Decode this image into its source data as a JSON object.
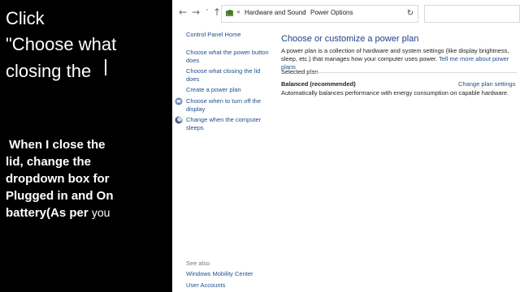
{
  "instructions": {
    "line1": "Click",
    "line2": "\"Choose what",
    "line3": "closing the",
    "body_lines": [
      " When I close the",
      "lid, change the",
      "dropdown box for",
      "Plugged in and On",
      "battery(As per"
    ],
    "trailing": "you"
  },
  "address_bar": {
    "back_icon": "arrow-left-icon",
    "forward_icon": "arrow-right-icon",
    "recent_icon": "chevron-down-icon",
    "up_icon": "arrow-up-icon",
    "chevrons": "«",
    "crumb1": "Hardware and Sound",
    "sep": "›",
    "crumb2": "Power Options",
    "dropdown_icon": "chevron-down-icon",
    "refresh_icon": "refresh-icon",
    "search_placeholder": ""
  },
  "nav": {
    "home": "Control Panel Home",
    "items": [
      "Choose what the power button does",
      "Choose what closing the lid does",
      "Create a power plan",
      "Choose when to turn off the display",
      "Change when the computer sleeps"
    ],
    "see_also": "See also",
    "see_also_items": [
      "Windows Mobility Center",
      "User Accounts"
    ]
  },
  "main": {
    "title": "Choose or customize a power plan",
    "desc": "A power plan is a collection of hardware and system settings (like display brightness, sleep, etc.) that manages how your computer uses power.",
    "desc_link": "Tell me more about power plans",
    "selected_plan_label": "Selected plan",
    "plan_name": "Balanced (recommended)",
    "change_settings": "Change plan settings",
    "plan_desc": "Automatically balances performance with energy consumption on capable hardware."
  }
}
